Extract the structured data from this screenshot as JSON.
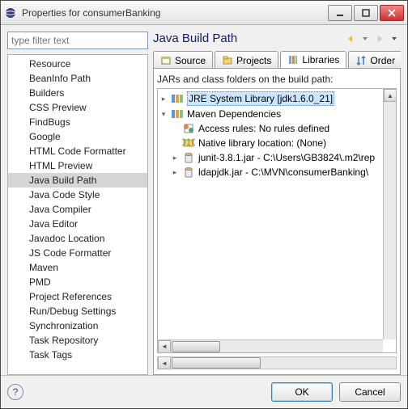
{
  "window": {
    "title": "Properties for consumerBanking"
  },
  "filter": {
    "placeholder": "type filter text"
  },
  "nav": {
    "items": [
      "Resource",
      "BeanInfo Path",
      "Builders",
      "CSS Preview",
      "FindBugs",
      "Google",
      "HTML Code Formatter",
      "HTML Preview",
      "Java Build Path",
      "Java Code Style",
      "Java Compiler",
      "Java Editor",
      "Javadoc Location",
      "JS Code Formatter",
      "Maven",
      "PMD",
      "Project References",
      "Run/Debug Settings",
      "Synchronization",
      "Task Repository",
      "Task Tags"
    ],
    "selected_index": 8
  },
  "page": {
    "title": "Java Build Path",
    "tabs": [
      "Source",
      "Projects",
      "Libraries",
      "Order"
    ],
    "active_tab": 2,
    "description": "JARs and class folders on the build path:",
    "tree": [
      {
        "level": 0,
        "expand": "closed",
        "icon": "library",
        "label": "JRE System Library [jdk1.6.0_21]",
        "selected": true
      },
      {
        "level": 0,
        "expand": "open",
        "icon": "library",
        "label": "Maven Dependencies"
      },
      {
        "level": 1,
        "expand": "none",
        "icon": "rules",
        "label": "Access rules: No rules defined"
      },
      {
        "level": 1,
        "expand": "none",
        "icon": "native",
        "label": "Native library location: (None)"
      },
      {
        "level": 1,
        "expand": "closed",
        "icon": "jar",
        "label": "junit-3.8.1.jar - C:\\Users\\GB3824\\.m2\\rep"
      },
      {
        "level": 1,
        "expand": "closed",
        "icon": "jar",
        "label": "ldapjdk.jar - C:\\MVN\\consumerBanking\\"
      }
    ]
  },
  "buttons": {
    "ok": "OK",
    "cancel": "Cancel"
  }
}
